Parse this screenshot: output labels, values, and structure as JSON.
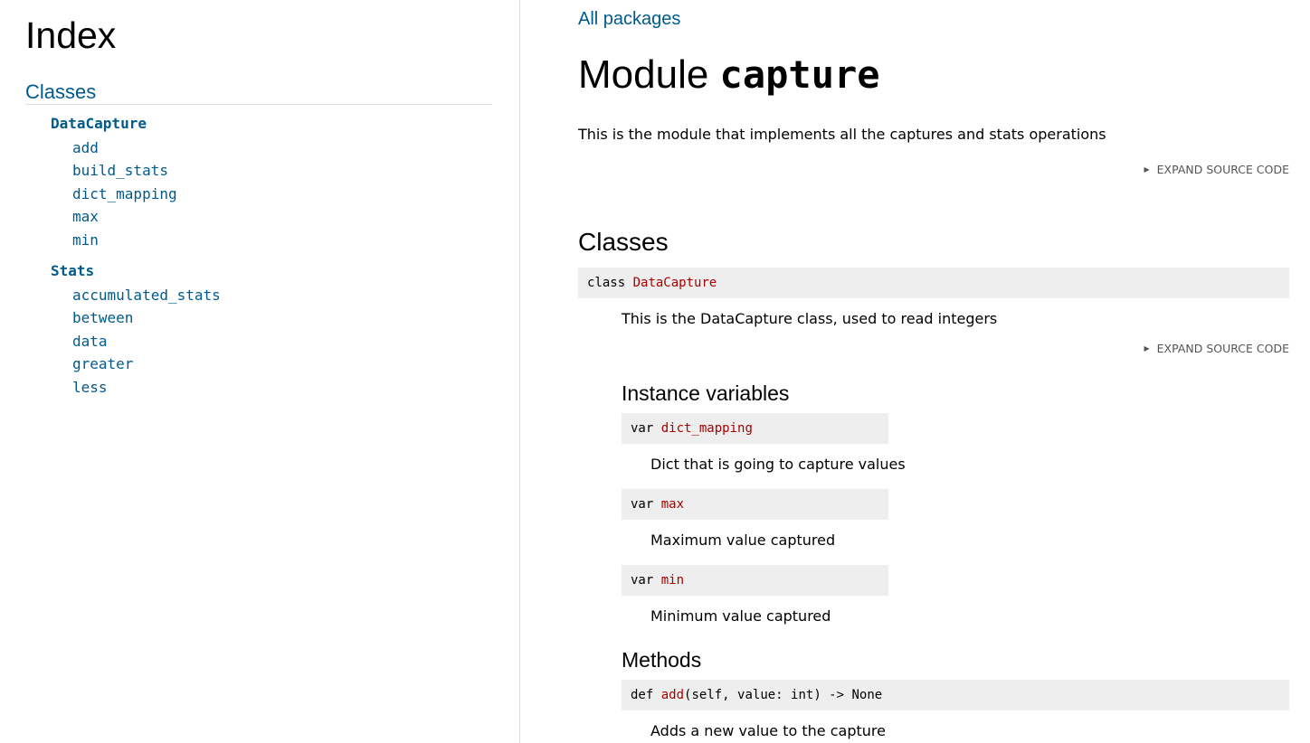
{
  "sidebar": {
    "title": "Index",
    "section": "Classes",
    "classes": [
      {
        "name": "DataCapture",
        "members": [
          "add",
          "build_stats",
          "dict_mapping",
          "max",
          "min"
        ]
      },
      {
        "name": "Stats",
        "members": [
          "accumulated_stats",
          "between",
          "data",
          "greater",
          "less"
        ]
      }
    ]
  },
  "main": {
    "breadcrumb": "All packages",
    "title_prefix": "Module",
    "title_module": "capture",
    "description": "This is the module that implements all the captures and stats operations",
    "expand_label": "Expand source code",
    "expand_icon": "triangle-right-icon",
    "classes_heading": "Classes",
    "class_decl": {
      "keyword": "class",
      "name": "DataCapture"
    },
    "class_description": "This is the DataCapture class, used to read integers",
    "instance_vars_heading": "Instance variables",
    "instance_vars": [
      {
        "keyword": "var",
        "name": "dict_mapping",
        "description": "Dict that is going to capture values"
      },
      {
        "keyword": "var",
        "name": "max",
        "description": "Maximum value captured"
      },
      {
        "keyword": "var",
        "name": "min",
        "description": "Minimum value captured"
      }
    ],
    "methods_heading": "Methods",
    "methods": [
      {
        "keyword": "def",
        "name": "add",
        "signature": "(self, value: int) -> None",
        "description": "Adds a new value to the capture"
      }
    ]
  }
}
